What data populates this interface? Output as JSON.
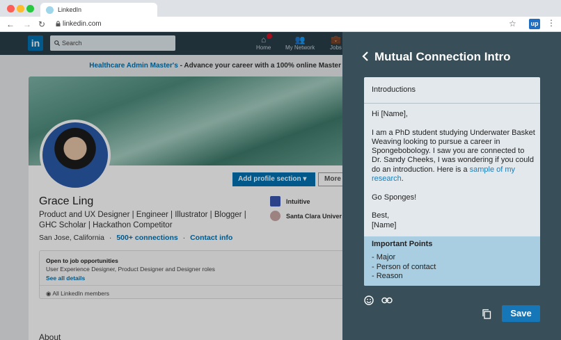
{
  "browser": {
    "tab_title": "LinkedIn",
    "url": "linkedin.com",
    "extension_label": "up"
  },
  "linkedin": {
    "logo": "in",
    "search_placeholder": "Search",
    "nav": [
      {
        "label": "Home",
        "icon": "home-icon"
      },
      {
        "label": "My Network",
        "icon": "network-icon"
      },
      {
        "label": "Jobs",
        "icon": "jobs-icon"
      }
    ],
    "ad": {
      "link": "Healthcare Admin Master's",
      "text": " - Advance your career with a 100% online Master"
    },
    "profile": {
      "add_section": "Add profile section",
      "more": "More",
      "name": "Grace Ling",
      "headline": "Product and UX Designer | Engineer | Illustrator | Blogger | GHC Scholar | Hackathon Competitor",
      "location": "San Jose, California",
      "sep": "·",
      "connections": "500+ connections",
      "contact": "Contact info",
      "companies": [
        {
          "name": "Intuitive",
          "color": "#3a57b0"
        },
        {
          "name": "Santa Clara Univer",
          "color": "#c9a7a7"
        }
      ],
      "open_title": "Open to job opportunities",
      "open_roles": "User Experience Designer, Product Designer and Designer roles",
      "see_all": "See all details",
      "visibility": "All LinkedIn members",
      "about": "About"
    }
  },
  "panel": {
    "title": "Mutual Connection Intro",
    "subject": "Introductions",
    "greeting": "Hi [Name],",
    "body_text": "I am a PhD student studying Underwater Basket Weaving looking to pursue a career in Spongebobology. I saw you are connected to Dr. Sandy Cheeks, I was wondering if you could do an introduction. Here is a ",
    "body_link": "sample of my research",
    "body_end": ".",
    "closing": "Go Sponges!",
    "signoff": "Best,",
    "signature": "[Name]",
    "points_title": "Important Points",
    "points": [
      "- Major",
      "- Person of contact",
      "- Reason"
    ],
    "save_label": "Save"
  }
}
